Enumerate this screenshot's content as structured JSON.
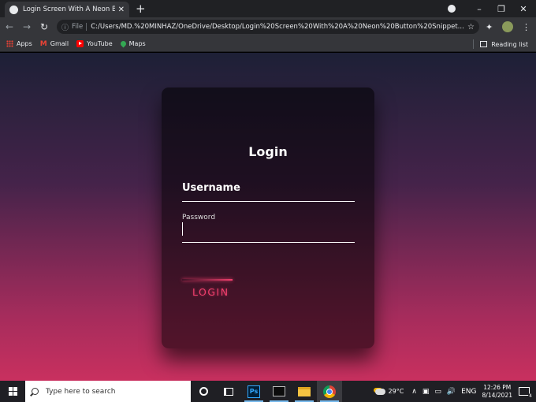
{
  "browser": {
    "tab_title": "Login Screen With A Neon Button",
    "tab_close": "✕",
    "new_tab": "+",
    "address_scheme": "File",
    "address_url": "C:/Users/MD.%20MINHAZ/OneDrive/Desktop/Login%20Screen%20With%20A%20Neon%20Button%20Snippet...",
    "bookmarks": [
      {
        "label": "Apps",
        "icon": "apps-icon"
      },
      {
        "label": "Gmail",
        "icon": "gmail-icon"
      },
      {
        "label": "YouTube",
        "icon": "youtube-icon"
      },
      {
        "label": "Maps",
        "icon": "maps-icon"
      }
    ],
    "reading_list": "Reading list"
  },
  "login": {
    "title": "Login",
    "username_label": "Username",
    "password_label": "Password",
    "button_label": "LOGIN",
    "accent_color": "#f13f6d",
    "gradient_top": "#1d2036",
    "gradient_bottom": "#c9305f"
  },
  "taskbar": {
    "search_placeholder": "Type here to search",
    "ps_label": "Ps",
    "temperature": "29°C",
    "language": "ENG",
    "time": "12:26 PM",
    "date": "8/14/2021",
    "notifications": "4"
  }
}
